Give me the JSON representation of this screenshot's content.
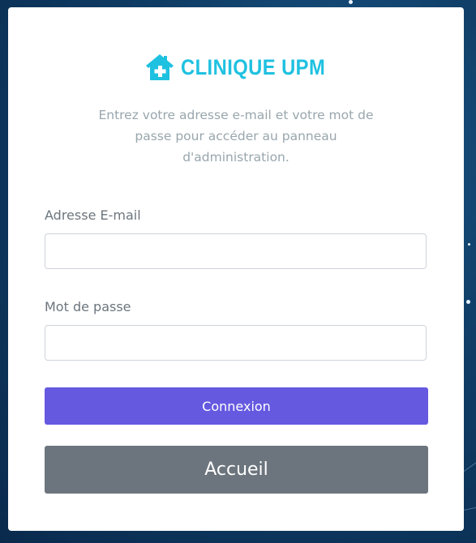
{
  "brand": {
    "icon": "house-medical-icon",
    "name": "CLINIQUE UPM",
    "color": "#1fc1e0"
  },
  "intro": "Entrez votre adresse e-mail et votre mot de passe pour accéder au panneau d'administration.",
  "form": {
    "email_label": "Adresse E-mail",
    "email_value": "",
    "password_label": "Mot de passe",
    "password_value": ""
  },
  "buttons": {
    "login_label": "Connexion",
    "login_color": "#6559e0",
    "home_label": "Accueil",
    "home_color": "#6c757d"
  }
}
